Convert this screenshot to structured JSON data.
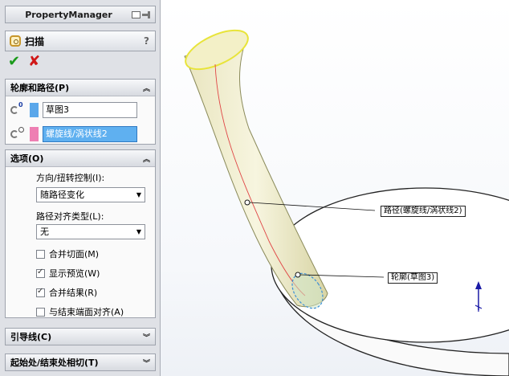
{
  "panel": {
    "title": "PropertyManager",
    "feature_name": "扫描",
    "help": "?",
    "ok_symbol": "✔",
    "cancel_symbol": "✘"
  },
  "profile_path": {
    "header": "轮廓和路径(P)",
    "profile_value": "草图3",
    "path_value": "螺旋线/涡状线2",
    "profile_color": "#5aa7ea",
    "path_color": "#ee7fb3"
  },
  "options": {
    "header": "选项(O)",
    "orient_label": "方向/扭转控制(I):",
    "orient_value": "随路径变化",
    "align_label": "路径对齐类型(L):",
    "align_value": "无",
    "checkboxes": [
      {
        "label": "合并切面(M)",
        "checked": false
      },
      {
        "label": "显示预览(W)",
        "checked": true
      },
      {
        "label": "合并结果(R)",
        "checked": true
      },
      {
        "label": "与结束端面对齐(A)",
        "checked": false
      }
    ]
  },
  "collapsed_groups": [
    "引导线(C)",
    "起始处/结束处相切(T)"
  ],
  "viewport": {
    "path_callout": "路径(螺旋线/涡状线2)",
    "profile_callout": "轮廓(草图3)"
  }
}
